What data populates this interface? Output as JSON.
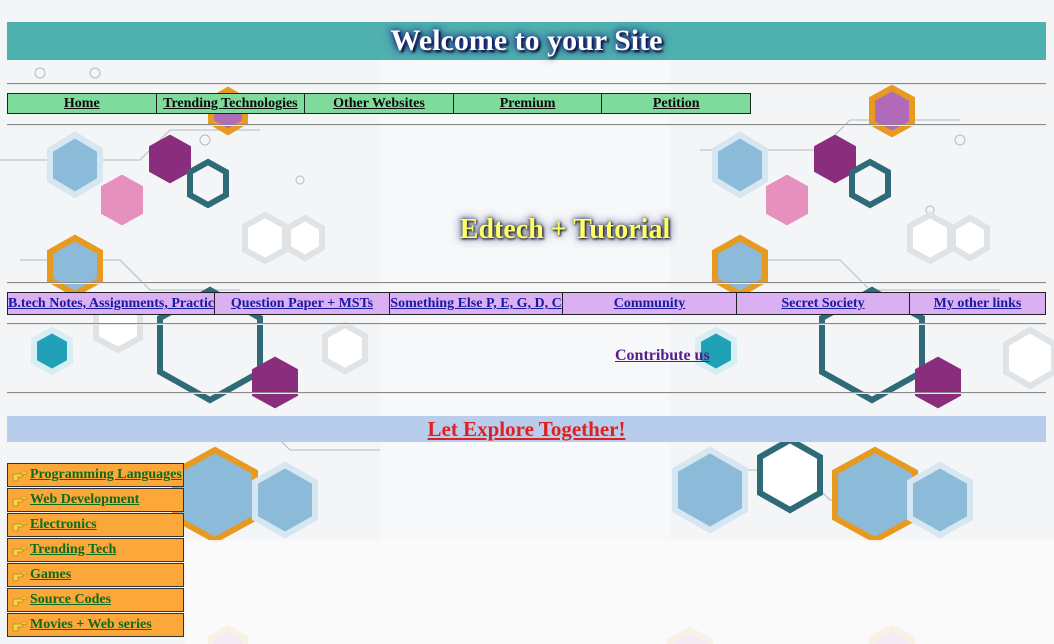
{
  "header": {
    "title": "Welcome to your Site"
  },
  "top_nav": {
    "items": [
      {
        "label": "Home"
      },
      {
        "label": "Trending Technologies"
      },
      {
        "label": "Other Websites"
      },
      {
        "label": "Premium"
      },
      {
        "label": "Petition"
      }
    ]
  },
  "subtitle": "Edtech + Tutorial",
  "secondary_nav": {
    "items": [
      {
        "label": "B.tech Notes, Assignments, Practicals"
      },
      {
        "label": "Question Paper + MSTs"
      },
      {
        "label": "Something Else P, E, G, D, C"
      },
      {
        "label": "Community"
      },
      {
        "label": "Secret Society"
      },
      {
        "label": "My other links"
      }
    ]
  },
  "contribute_label": "Contribute us",
  "explore_label": "Let Explore Together!",
  "side_menu": {
    "icon": "pointing-hand-icon",
    "items": [
      {
        "label": "Programming Languages"
      },
      {
        "label": "Web Development"
      },
      {
        "label": "Electronics"
      },
      {
        "label": "Trending Tech"
      },
      {
        "label": "Games"
      },
      {
        "label": "Source Codes"
      },
      {
        "label": "Movies + Web series"
      }
    ]
  },
  "colors": {
    "header_bg": "#4fb0b0",
    "top_nav_bg": "#7edb9b",
    "secondary_nav_bg": "#dab0f2",
    "explore_bg": "#b8cdec",
    "side_menu_bg": "#fba73a"
  }
}
